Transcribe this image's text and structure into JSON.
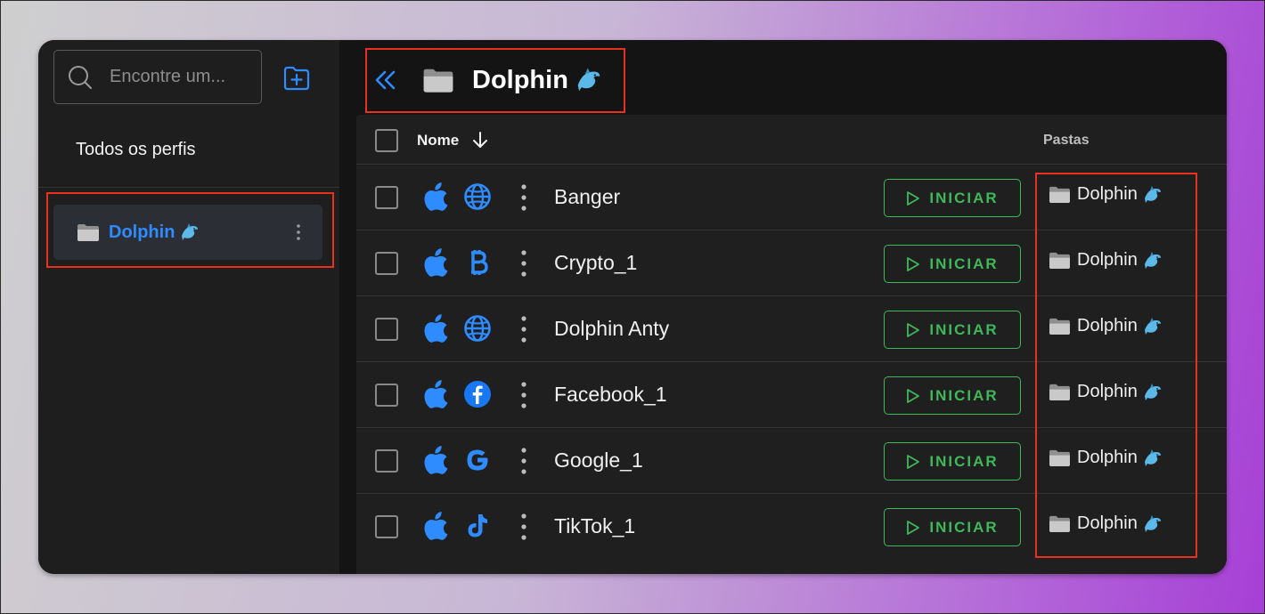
{
  "sidebar": {
    "search_placeholder": "Encontre um...",
    "all_profiles_label": "Todos os perfis",
    "folder": {
      "name": "Dolphin"
    }
  },
  "header": {
    "title": "Dolphin"
  },
  "table": {
    "columns": {
      "name": "Nome",
      "folders": "Pastas"
    },
    "start_label": "INICIAR",
    "rows": [
      {
        "name": "Banger",
        "os_icon": "apple-icon",
        "type_icon": "globe-icon",
        "folder": "Dolphin"
      },
      {
        "name": "Crypto_1",
        "os_icon": "apple-icon",
        "type_icon": "bitcoin-icon",
        "folder": "Dolphin"
      },
      {
        "name": "Dolphin Anty",
        "os_icon": "apple-icon",
        "type_icon": "globe-icon",
        "folder": "Dolphin"
      },
      {
        "name": "Facebook_1",
        "os_icon": "apple-icon",
        "type_icon": "facebook-icon",
        "folder": "Dolphin"
      },
      {
        "name": "Google_1",
        "os_icon": "apple-icon",
        "type_icon": "google-icon",
        "folder": "Dolphin"
      },
      {
        "name": "TikTok_1",
        "os_icon": "apple-icon",
        "type_icon": "tiktok-icon",
        "folder": "Dolphin"
      }
    ]
  },
  "colors": {
    "accent_blue": "#2f8cff",
    "start_green": "#3fb85a",
    "highlight_red": "#e8321d",
    "background": "#141414",
    "sidebar": "#1e1e1e"
  }
}
